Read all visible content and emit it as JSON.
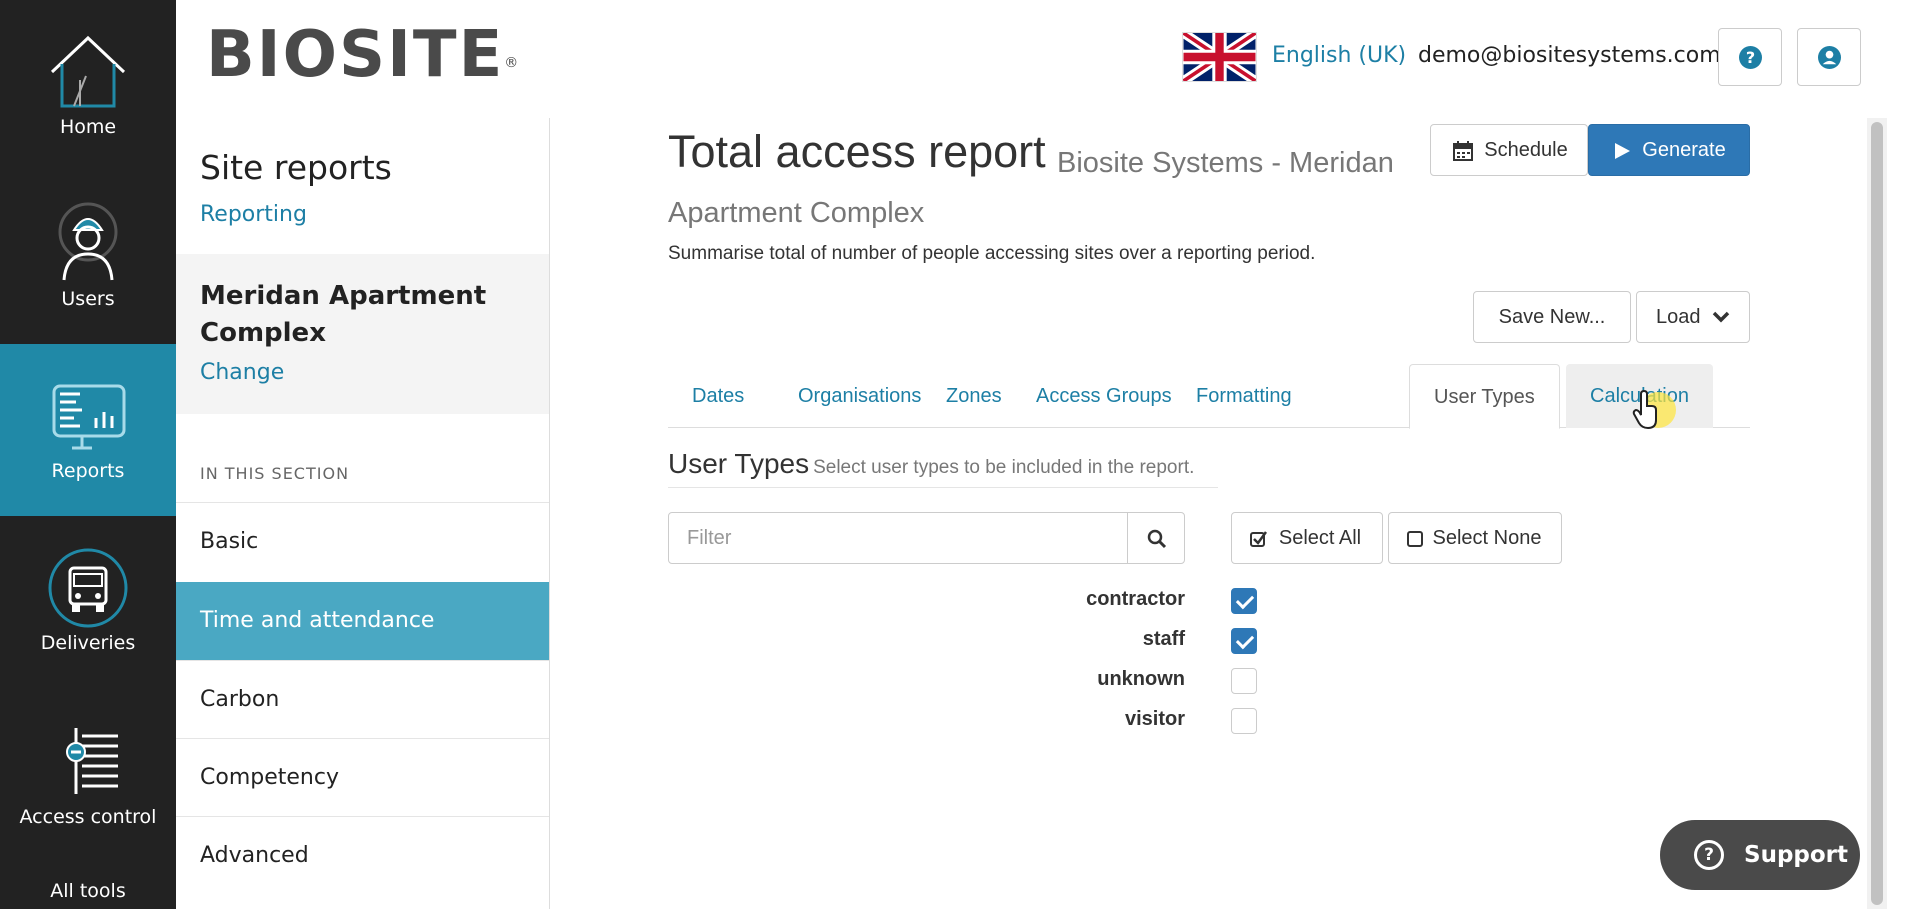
{
  "colors": {
    "accent": "#1d7fa5",
    "nav_bg": "#222222",
    "nav_active": "#2089a7",
    "sidebar_active": "#4aa8c3",
    "primary_button": "#2e78b7"
  },
  "appnav": {
    "items": [
      {
        "label": "Home",
        "icon": "house-icon",
        "active": false
      },
      {
        "label": "Users",
        "icon": "worker-icon",
        "active": false
      },
      {
        "label": "Reports",
        "icon": "report-chart-icon",
        "active": true
      },
      {
        "label": "Deliveries",
        "icon": "truck-icon",
        "active": false
      },
      {
        "label": "Access control",
        "icon": "turnstile-icon",
        "active": false
      }
    ],
    "all_tools": "All tools"
  },
  "header": {
    "logo": "BIOSITE",
    "logo_mark": "®",
    "language": "English (UK)",
    "flag_icon": "uk-flag-icon",
    "email": "demo@biositesystems.com",
    "help_icon": "help-icon",
    "user_icon": "user-account-icon"
  },
  "sidebar": {
    "title": "Site reports",
    "subtitle": "Reporting",
    "site_name": "Meridan Apartment Complex",
    "change_label": "Change",
    "section_label": "IN THIS SECTION",
    "items": [
      {
        "label": "Basic",
        "active": false
      },
      {
        "label": "Time and attendance",
        "active": true
      },
      {
        "label": "Carbon",
        "active": false
      },
      {
        "label": "Competency",
        "active": false
      },
      {
        "label": "Advanced",
        "active": false
      }
    ]
  },
  "main": {
    "title": "Total access report",
    "subtitle": "Biosite Systems - Meridan Apartment Complex",
    "description": "Summarise total of number of people accessing sites over a reporting period.",
    "schedule_label": "Schedule",
    "generate_label": "Generate",
    "save_new_label": "Save New...",
    "load_label": "Load",
    "tabs": [
      {
        "label": "Dates"
      },
      {
        "label": "Organisations"
      },
      {
        "label": "Zones"
      },
      {
        "label": "Access Groups"
      },
      {
        "label": "Formatting"
      },
      {
        "label": "User Types",
        "active": true
      },
      {
        "label": "Calculation",
        "hover": true
      }
    ],
    "user_types": {
      "heading": "User Types",
      "help": "Select user types to be included in the report.",
      "filter_placeholder": "Filter",
      "select_all_label": "Select All",
      "select_none_label": "Select None",
      "items": [
        {
          "label": "contractor",
          "checked": true
        },
        {
          "label": "staff",
          "checked": true
        },
        {
          "label": "unknown",
          "checked": false
        },
        {
          "label": "visitor",
          "checked": false
        }
      ]
    }
  },
  "support_label": "Support"
}
